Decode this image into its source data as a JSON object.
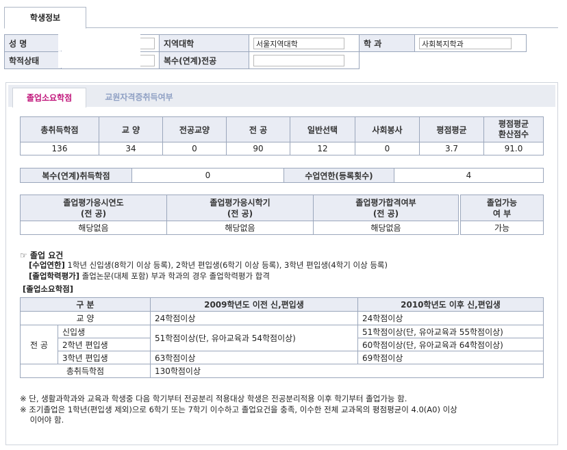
{
  "top_tab": "학생정보",
  "info": {
    "name_label": "성    명",
    "region_label": "지역대학",
    "region_value": "서울지역대학",
    "dept_label": "학    과",
    "dept_value": "사회복지학과",
    "status_label": "학적상태",
    "double_major_label": "복수(연계)전공",
    "double_major_value": ""
  },
  "tabs": [
    "졸업소요학점",
    "교원자격증취득여부"
  ],
  "credits": {
    "headers": [
      "총취득학점",
      "교    양",
      "전공교양",
      "전    공",
      "일반선택",
      "사회봉사",
      "평점평균",
      "평점평균\n환산점수"
    ],
    "values": [
      "136",
      "34",
      "0",
      "90",
      "12",
      "0",
      "3.7",
      "91.0"
    ]
  },
  "double_credit": {
    "label": "복수(연계)취득학점",
    "value": "0",
    "years_label": "수업연한(등록횟수)",
    "years_value": "4"
  },
  "exam": {
    "headers": [
      "졸업평가응시연도\n(전    공)",
      "졸업평가응시학기\n(전    공)",
      "졸업평가합격여부\n(전    공)"
    ],
    "values": [
      "해당없음",
      "해당없음",
      "해당없음"
    ],
    "possible_header": "졸업가능\n여    부",
    "possible_value": "가능"
  },
  "requirements": {
    "title": "☞ 졸업 요건",
    "line1_label": "[수업연한]",
    "line1_text": " 1학년 신입생(8학기 이상 등록), 2학년 편입생(6학기 이상 등록), 3학년 편입생(4학기 이상 등록)",
    "line2_label": "[졸업학력평가]",
    "line2_text": " 졸업논문(대체 포함) 부과 학과의 경우 졸업학력평가 합격",
    "section_label": "[졸업소요학점]"
  },
  "req_table": {
    "h_div": "구    분",
    "h_2009": "2009학년도 이전 신,편입생",
    "h_2010": "2010학년도 이후 신,편입생",
    "r_liberal": "교    양",
    "r_liberal_2009": "24학점이상",
    "r_liberal_2010": "24학점이상",
    "r_major": "전    공",
    "r_new": "신입생",
    "r_2nd": "2학년 편입생",
    "r_3rd": "3학년 편입생",
    "r_major_2009": "51학점이상(단, 유아교육과 54학점이상)",
    "r_new_2010": "51학점이상(단, 유아교육과 55학점이상)",
    "r_2nd_2010": "60학점이상(단, 유아교육과 64학점이상)",
    "r_3rd_2009": "63학점이상",
    "r_3rd_2010": "69학점이상",
    "r_total": "총취득학점",
    "r_total_val": "130학점이상"
  },
  "notes": [
    "※ 단, 생활과학과와 교육과 학생중 다음 학기부터 전공분리 적용대상 학생은 전공분리적용 이후 학기부터 졸업가능 함.",
    "※ 조기졸업은 1학년(편입생 제외)으로 6학기 또는 7학기 이수하고 졸업요건을 충족, 이수한 전체 교과목의 평점평균이 4.0(A0) 이상",
    "    이어야 함."
  ]
}
